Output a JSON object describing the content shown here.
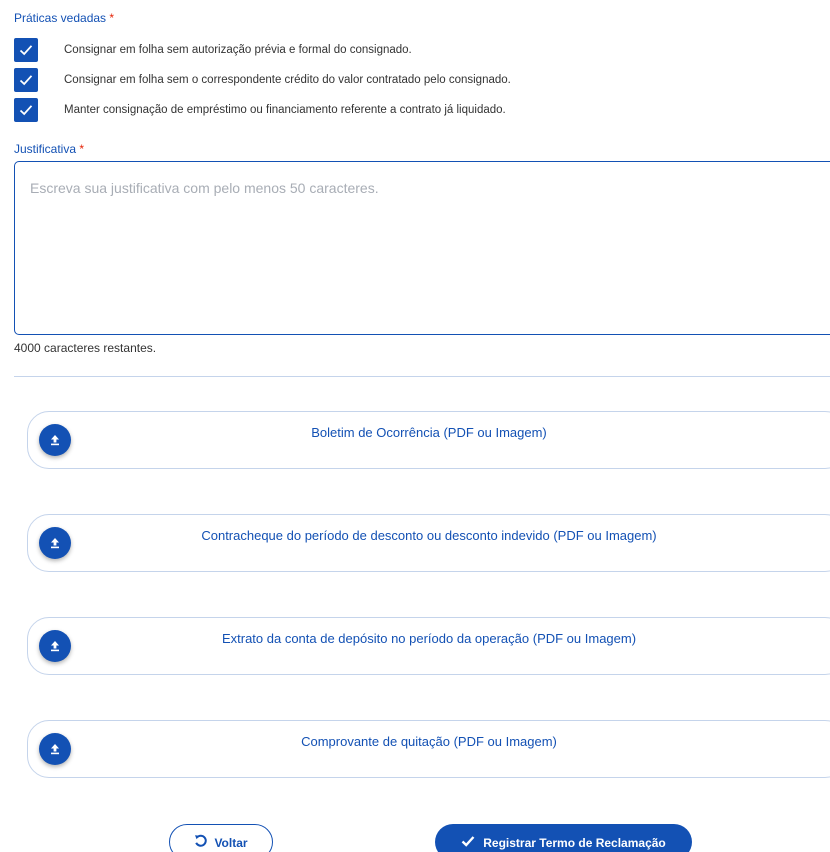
{
  "praticas": {
    "label": "Práticas vedadas",
    "required_mark": "*",
    "items": [
      {
        "label": "Consignar em folha sem autorização prévia e formal do consignado.",
        "checked": true
      },
      {
        "label": "Consignar em folha sem o correspondente crédito do valor contratado pelo consignado.",
        "checked": true
      },
      {
        "label": "Manter consignação de empréstimo ou financiamento referente a contrato já liquidado.",
        "checked": true
      }
    ]
  },
  "justificativa": {
    "label": "Justificativa",
    "required_mark": "*",
    "placeholder": "Escreva sua justificativa com pelo menos 50 caracteres.",
    "counter": "4000 caracteres restantes."
  },
  "uploads": [
    {
      "label": "Boletim de Ocorrência  (PDF ou Imagem)",
      "icon": "upload-icon"
    },
    {
      "label": "Contracheque do período de desconto ou desconto indevido  (PDF ou Imagem)",
      "icon": "upload-icon"
    },
    {
      "label": "Extrato da conta de depósito no período da operação  (PDF ou Imagem)",
      "icon": "upload-icon"
    },
    {
      "label": "Comprovante de quitação  (PDF ou Imagem)",
      "icon": "upload-icon"
    }
  ],
  "actions": {
    "back_label": "Voltar",
    "back_icon": "undo-icon",
    "submit_label": "Registrar Termo de Reclamação",
    "submit_icon": "check-icon"
  },
  "colors": {
    "primary": "#1351b4",
    "required": "#e52207",
    "border_light": "#c5d4eb",
    "placeholder": "#a8adb5"
  }
}
